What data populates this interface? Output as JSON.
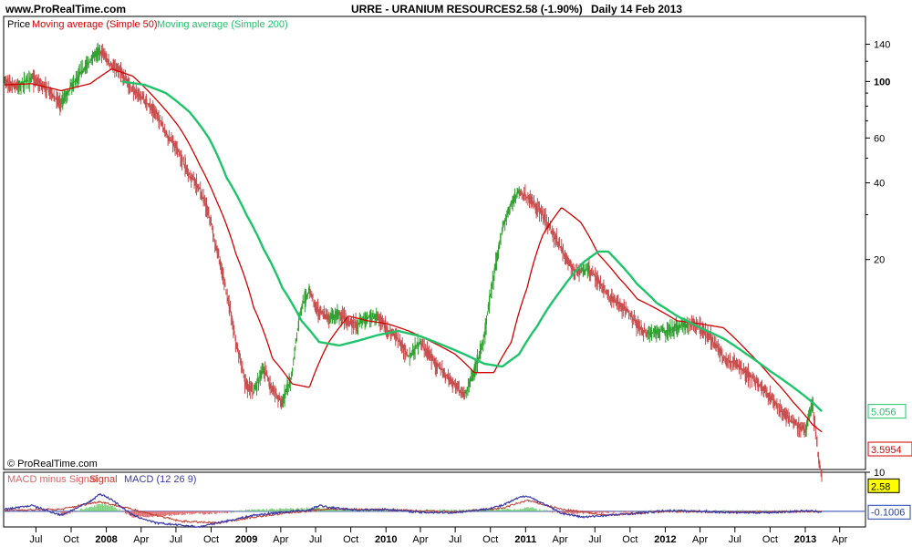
{
  "header": {
    "site": "www.ProRealTime.com",
    "symbol": "URRE - URANIUM RESOURCES",
    "price_change": "2.58 (-1.90%)",
    "timeframe": "Daily  14 Feb 2013"
  },
  "legend_price": {
    "price": "Price",
    "ma50": "Moving average (Simple 50)",
    "ma200": "Moving average (Simple 200)"
  },
  "legend_macd": {
    "a": "MACD minus Signal",
    "b": "Signal",
    "c": "MACD (12 26 9)"
  },
  "copyright": "© ProRealTime.com",
  "colors": {
    "price_up": "#2ca02c",
    "price_down": "#c84b4b",
    "ma50": "#d40000",
    "ma200": "#1fc46a",
    "macd": "#3a3aa8",
    "signal_line": "#2040b0",
    "hist_pos": "#7fd07f",
    "hist_neg": "#e07070",
    "tag_yellow": "#ffff00"
  },
  "chart_data": [
    {
      "type": "line",
      "title": "URRE - URANIUM RESOURCES",
      "scale": "log",
      "ylim": [
        3,
        180
      ],
      "y_ticks": [
        140,
        100,
        60,
        40,
        20
      ],
      "y_tick_labels": [
        "140",
        "100",
        "60",
        "40",
        "20"
      ],
      "x_ticks": [
        "Jul",
        "Oct",
        "2008",
        "Apr",
        "Jul",
        "Oct",
        "2009",
        "Apr",
        "Jul",
        "Oct",
        "2010",
        "Apr",
        "Jul",
        "Oct",
        "2011",
        "Apr",
        "Jul",
        "Oct",
        "2012",
        "Apr",
        "Jul",
        "Oct",
        "2013",
        "Apr"
      ],
      "x_tick_dates": [
        "2007-07-01",
        "2007-10-01",
        "2008-01-01",
        "2008-04-01",
        "2008-07-01",
        "2008-10-01",
        "2009-01-01",
        "2009-04-01",
        "2009-07-01",
        "2009-10-01",
        "2010-01-01",
        "2010-04-01",
        "2010-07-01",
        "2010-10-01",
        "2011-01-01",
        "2011-04-01",
        "2011-07-01",
        "2011-10-01",
        "2012-01-01",
        "2012-04-01",
        "2012-07-01",
        "2012-10-01",
        "2013-01-01",
        "2013-04-01"
      ],
      "xlim": [
        "2007-04-10",
        "2013-06-05"
      ],
      "series": [
        {
          "name": "Price",
          "x": [
            "2007-04-10",
            "2007-05-15",
            "2007-06-20",
            "2007-07-25",
            "2007-09-05",
            "2007-10-20",
            "2007-11-20",
            "2007-12-15",
            "2008-01-15",
            "2008-02-10",
            "2008-03-10",
            "2008-04-10",
            "2008-05-10",
            "2008-06-05",
            "2008-07-10",
            "2008-08-05",
            "2008-09-01",
            "2008-09-25",
            "2008-10-15",
            "2008-11-10",
            "2008-12-05",
            "2008-12-30",
            "2009-01-20",
            "2009-02-15",
            "2009-03-10",
            "2009-04-05",
            "2009-05-01",
            "2009-05-25",
            "2009-06-15",
            "2009-07-10",
            "2009-08-05",
            "2009-09-01",
            "2009-09-25",
            "2009-10-20",
            "2009-11-15",
            "2009-12-10",
            "2010-01-05",
            "2010-02-01",
            "2010-03-01",
            "2010-04-01",
            "2010-05-01",
            "2010-06-01",
            "2010-07-01",
            "2010-07-25",
            "2010-08-20",
            "2010-09-15",
            "2010-10-10",
            "2010-11-01",
            "2010-11-25",
            "2010-12-15",
            "2011-01-05",
            "2011-01-25",
            "2011-02-15",
            "2011-03-10",
            "2011-04-05",
            "2011-05-01",
            "2011-05-25",
            "2011-06-15",
            "2011-07-10",
            "2011-08-05",
            "2011-09-01",
            "2011-09-25",
            "2011-10-20",
            "2011-11-15",
            "2011-12-10",
            "2012-01-05",
            "2012-02-01",
            "2012-03-01",
            "2012-04-01",
            "2012-05-01",
            "2012-06-01",
            "2012-07-01",
            "2012-08-01",
            "2012-09-01",
            "2012-10-01",
            "2012-11-01",
            "2012-12-01",
            "2013-01-01",
            "2013-01-20",
            "2013-02-05",
            "2013-02-14"
          ],
          "values": [
            100,
            96,
            103,
            95,
            82,
            105,
            120,
            133,
            115,
            108,
            92,
            85,
            75,
            63,
            52,
            43,
            38,
            30,
            22,
            15,
            9.5,
            6.5,
            6,
            7.5,
            6.2,
            5.5,
            7,
            13,
            15,
            12.5,
            11.8,
            12.2,
            11.5,
            11.2,
            11.8,
            12,
            10.5,
            9.8,
            8.3,
            9.5,
            8.2,
            7.2,
            6.5,
            5.8,
            7.2,
            9.8,
            17,
            26,
            33,
            37,
            35,
            33,
            30,
            26,
            22,
            18.5,
            18,
            18.5,
            16.5,
            14.5,
            13.5,
            12.5,
            11.2,
            10.2,
            10.5,
            10.5,
            10.8,
            11.2,
            10.8,
            9.8,
            8.3,
            7.8,
            7.2,
            6.5,
            5.8,
            5,
            4.6,
            4.3,
            5.4,
            3.3,
            2.58
          ]
        },
        {
          "name": "Moving average (Simple 50)",
          "x": [
            "2007-04-10",
            "2007-06-20",
            "2007-09-05",
            "2007-11-20",
            "2008-01-15",
            "2008-03-10",
            "2008-05-10",
            "2008-07-10",
            "2008-09-01",
            "2008-10-15",
            "2008-12-05",
            "2009-01-20",
            "2009-03-10",
            "2009-05-01",
            "2009-06-15",
            "2009-08-05",
            "2009-09-25",
            "2009-11-15",
            "2010-01-05",
            "2010-03-01",
            "2010-05-01",
            "2010-07-01",
            "2010-08-20",
            "2010-10-10",
            "2010-11-25",
            "2011-01-05",
            "2011-02-15",
            "2011-04-05",
            "2011-05-25",
            "2011-07-10",
            "2011-09-01",
            "2011-10-20",
            "2011-12-10",
            "2012-02-01",
            "2012-04-01",
            "2012-06-01",
            "2012-08-01",
            "2012-10-01",
            "2012-12-01",
            "2013-01-20",
            "2013-02-14"
          ],
          "values": [
            97,
            98,
            92,
            98,
            112,
            105,
            85,
            66,
            47,
            34,
            21,
            13,
            8.2,
            6.5,
            6.3,
            9.5,
            12,
            11.5,
            11.2,
            10.5,
            9.5,
            8.5,
            7.2,
            7.2,
            9.5,
            15.5,
            25,
            32,
            28,
            21,
            17,
            14,
            12.8,
            11.5,
            11.2,
            10.8,
            8.8,
            7,
            5.5,
            4.5,
            4.2
          ]
        },
        {
          "name": "Moving average (Simple 200)",
          "x": [
            "2008-02-10",
            "2008-04-10",
            "2008-06-05",
            "2008-08-05",
            "2008-09-25",
            "2008-11-10",
            "2009-01-01",
            "2009-02-15",
            "2009-04-05",
            "2009-05-25",
            "2009-07-10",
            "2009-09-01",
            "2009-10-20",
            "2009-12-10",
            "2010-02-01",
            "2010-04-01",
            "2010-06-01",
            "2010-07-25",
            "2010-09-15",
            "2010-11-01",
            "2010-12-15",
            "2011-02-01",
            "2011-04-01",
            "2011-06-01",
            "2011-07-10",
            "2011-08-05",
            "2011-09-01",
            "2011-10-20",
            "2011-12-10",
            "2012-02-01",
            "2012-04-01",
            "2012-06-01",
            "2012-08-01",
            "2012-10-01",
            "2012-12-01",
            "2013-01-20",
            "2013-02-14"
          ],
          "values": [
            100,
            97,
            90,
            76,
            60,
            42,
            30,
            22,
            15.5,
            11.5,
            9.5,
            9.2,
            9.6,
            10.1,
            10.5,
            10,
            9.2,
            8.5,
            7.8,
            7.6,
            8.5,
            11,
            15,
            19.5,
            21.5,
            21.5,
            19.5,
            16,
            13.5,
            12,
            10.8,
            9.8,
            8.5,
            7.3,
            6.3,
            5.5,
            5.056
          ]
        }
      ],
      "value_tags": [
        {
          "label": "5.056"
        },
        {
          "label": "3.5954"
        },
        {
          "label": "2.58"
        }
      ]
    },
    {
      "type": "line",
      "title": "MACD (12 26 9)",
      "ylim": [
        -4,
        10
      ],
      "y_ticks": [
        10
      ],
      "y_tick_labels": [
        "10"
      ],
      "value_tags": [
        {
          "label": "-0.1006"
        }
      ],
      "series": [
        {
          "name": "MACD",
          "x": [
            "2007-04-10",
            "2007-06-20",
            "2007-09-05",
            "2007-11-20",
            "2007-12-15",
            "2008-01-15",
            "2008-03-10",
            "2008-05-10",
            "2008-07-10",
            "2008-09-01",
            "2008-10-15",
            "2008-12-05",
            "2009-01-20",
            "2009-03-10",
            "2009-05-01",
            "2009-06-15",
            "2009-07-10",
            "2009-08-05",
            "2009-10-20",
            "2010-01-05",
            "2010-04-01",
            "2010-07-01",
            "2010-09-15",
            "2010-11-01",
            "2010-12-15",
            "2011-01-05",
            "2011-02-15",
            "2011-04-05",
            "2011-06-01",
            "2011-08-05",
            "2011-10-20",
            "2012-01-05",
            "2012-04-01",
            "2012-07-01",
            "2012-10-01",
            "2013-01-01",
            "2013-02-14"
          ],
          "values": [
            0.5,
            1.5,
            -1,
            2.5,
            4.5,
            3,
            -1,
            -3,
            -3.5,
            -4,
            -3,
            -2,
            -1,
            -0.5,
            0,
            0.3,
            1.5,
            1,
            0.3,
            0.5,
            -0.3,
            -0.3,
            0.5,
            1.5,
            3.5,
            4,
            2,
            -0.5,
            -1.5,
            -1,
            -0.5,
            0.2,
            0,
            -0.3,
            -0.3,
            0.1,
            -0.1
          ]
        },
        {
          "name": "Signal",
          "x": [
            "2007-04-10",
            "2007-09-05",
            "2007-12-15",
            "2008-03-10",
            "2008-07-10",
            "2008-10-15",
            "2009-01-20",
            "2009-05-01",
            "2009-08-05",
            "2010-01-05",
            "2010-07-01",
            "2010-11-01",
            "2011-01-05",
            "2011-04-05",
            "2011-08-05",
            "2012-01-05",
            "2012-07-01",
            "2013-01-01",
            "2013-02-14"
          ],
          "values": [
            0.3,
            0.5,
            2.5,
            0.5,
            -2.5,
            -3,
            -1.5,
            -0.3,
            0.6,
            0.4,
            -0.2,
            0.8,
            2.8,
            0.5,
            -1,
            0,
            -0.2,
            0,
            -0.05
          ]
        },
        {
          "name": "MACD minus Signal",
          "x": [
            "2007-09-05",
            "2007-12-15",
            "2008-01-15",
            "2008-03-10",
            "2008-05-10",
            "2008-07-10",
            "2008-10-15",
            "2009-01-20",
            "2009-07-10",
            "2010-01-05",
            "2010-12-15",
            "2011-01-05",
            "2011-04-05",
            "2011-06-01",
            "2012-01-05",
            "2013-02-14"
          ],
          "values": [
            -1,
            1.8,
            1.5,
            -1.5,
            -1.2,
            -0.8,
            -0.5,
            0.4,
            0.8,
            0.1,
            0.6,
            1,
            -0.6,
            -0.5,
            0.2,
            -0.05
          ]
        }
      ]
    }
  ]
}
